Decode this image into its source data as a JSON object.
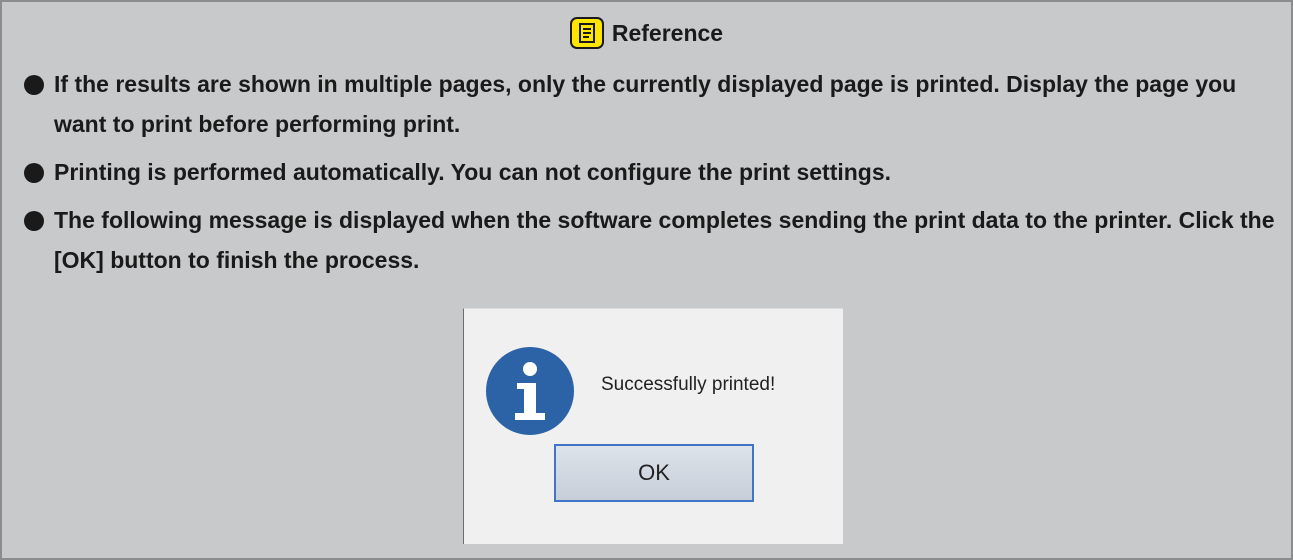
{
  "reference": {
    "title": "Reference",
    "icon": "note-icon"
  },
  "bullets": [
    "If the results are shown in multiple pages, only the currently displayed page is printed. Display the page you want to print before performing print.",
    "Printing is performed automatically. You can not configure the print settings.",
    "The following message is displayed when the software completes sending the print data to the printer. Click the [OK] button to finish the process."
  ],
  "dialog": {
    "icon": "info-icon",
    "message": "Successfully printed!",
    "ok_label": "OK"
  },
  "colors": {
    "panel_bg": "#c8c9cb",
    "panel_border": "#8c8c8e",
    "icon_yellow": "#ffe600",
    "info_blue": "#2b63a6",
    "button_border": "#3f74c7"
  }
}
